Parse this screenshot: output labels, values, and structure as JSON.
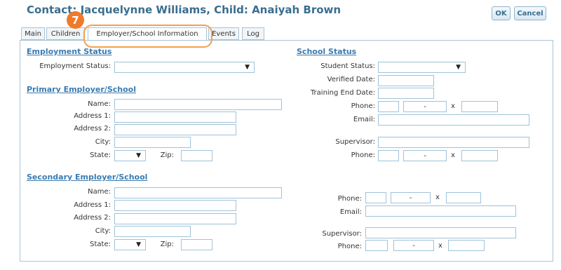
{
  "header": {
    "title": "Contact: Jacquelynne Williams, Child: Anaiyah Brown",
    "ok_label": "OK",
    "cancel_label": "Cancel"
  },
  "tabs": [
    {
      "label": "Main"
    },
    {
      "label": "Children"
    },
    {
      "label": "Employer/School Information"
    },
    {
      "label": "Events"
    },
    {
      "label": "Log"
    }
  ],
  "marker": {
    "number": "7"
  },
  "employment": {
    "heading": "Employment Status",
    "status_label": "Employment Status:",
    "status_value": ""
  },
  "primary": {
    "heading": "Primary Employer/School",
    "name_label": "Name:",
    "address1_label": "Address 1:",
    "address2_label": "Address 2:",
    "city_label": "City:",
    "state_label": "State:",
    "zip_label": "Zip:"
  },
  "secondary": {
    "heading": "Secondary Employer/School",
    "name_label": "Name:",
    "address1_label": "Address 1:",
    "address2_label": "Address 2:",
    "city_label": "City:",
    "state_label": "State:",
    "zip_label": "Zip:"
  },
  "school": {
    "heading": "School Status",
    "student_status_label": "Student Status:",
    "verified_date_label": "Verified Date:",
    "training_end_label": "Training End Date:",
    "phone_label": "Phone:",
    "email_label": "Email:",
    "supervisor_label": "Supervisor:",
    "supervisor_phone_label": "Phone:"
  },
  "secondary_contact": {
    "phone_label": "Phone:",
    "email_label": "Email:",
    "supervisor_label": "Supervisor:",
    "supervisor_phone_label": "Phone:"
  },
  "phone": {
    "dash": "-",
    "ext_sep": "x"
  },
  "icons": {
    "dropdown": "down-triangle-icon"
  }
}
